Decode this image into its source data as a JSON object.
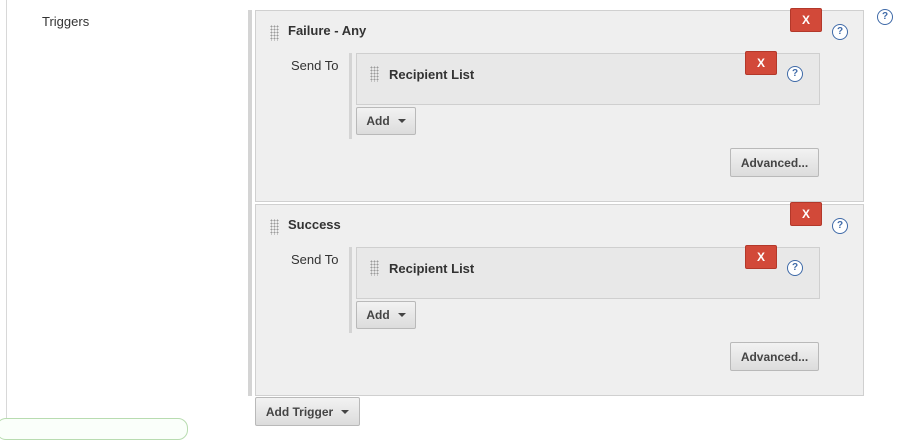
{
  "form": {
    "triggers_label": "Triggers",
    "add_trigger_label": "Add Trigger",
    "help_icon_glyph": "?"
  },
  "triggers": [
    {
      "title": "Failure - Any",
      "delete_label": "X",
      "help_glyph": "?",
      "send_to_label": "Send To",
      "recipients": [
        {
          "title": "Recipient List",
          "delete_label": "X",
          "help_glyph": "?"
        }
      ],
      "add_label": "Add",
      "advanced_label": "Advanced..."
    },
    {
      "title": "Success",
      "delete_label": "X",
      "help_glyph": "?",
      "send_to_label": "Send To",
      "recipients": [
        {
          "title": "Recipient List",
          "delete_label": "X",
          "help_glyph": "?"
        }
      ],
      "add_label": "Add",
      "advanced_label": "Advanced..."
    }
  ],
  "colors": {
    "delete_button": "#d24939",
    "help_icon": "#3f6aa8",
    "panel_bg": "#efefef"
  },
  "icons": [
    "drag-handle-icon",
    "help-icon",
    "caret-down-icon"
  ]
}
